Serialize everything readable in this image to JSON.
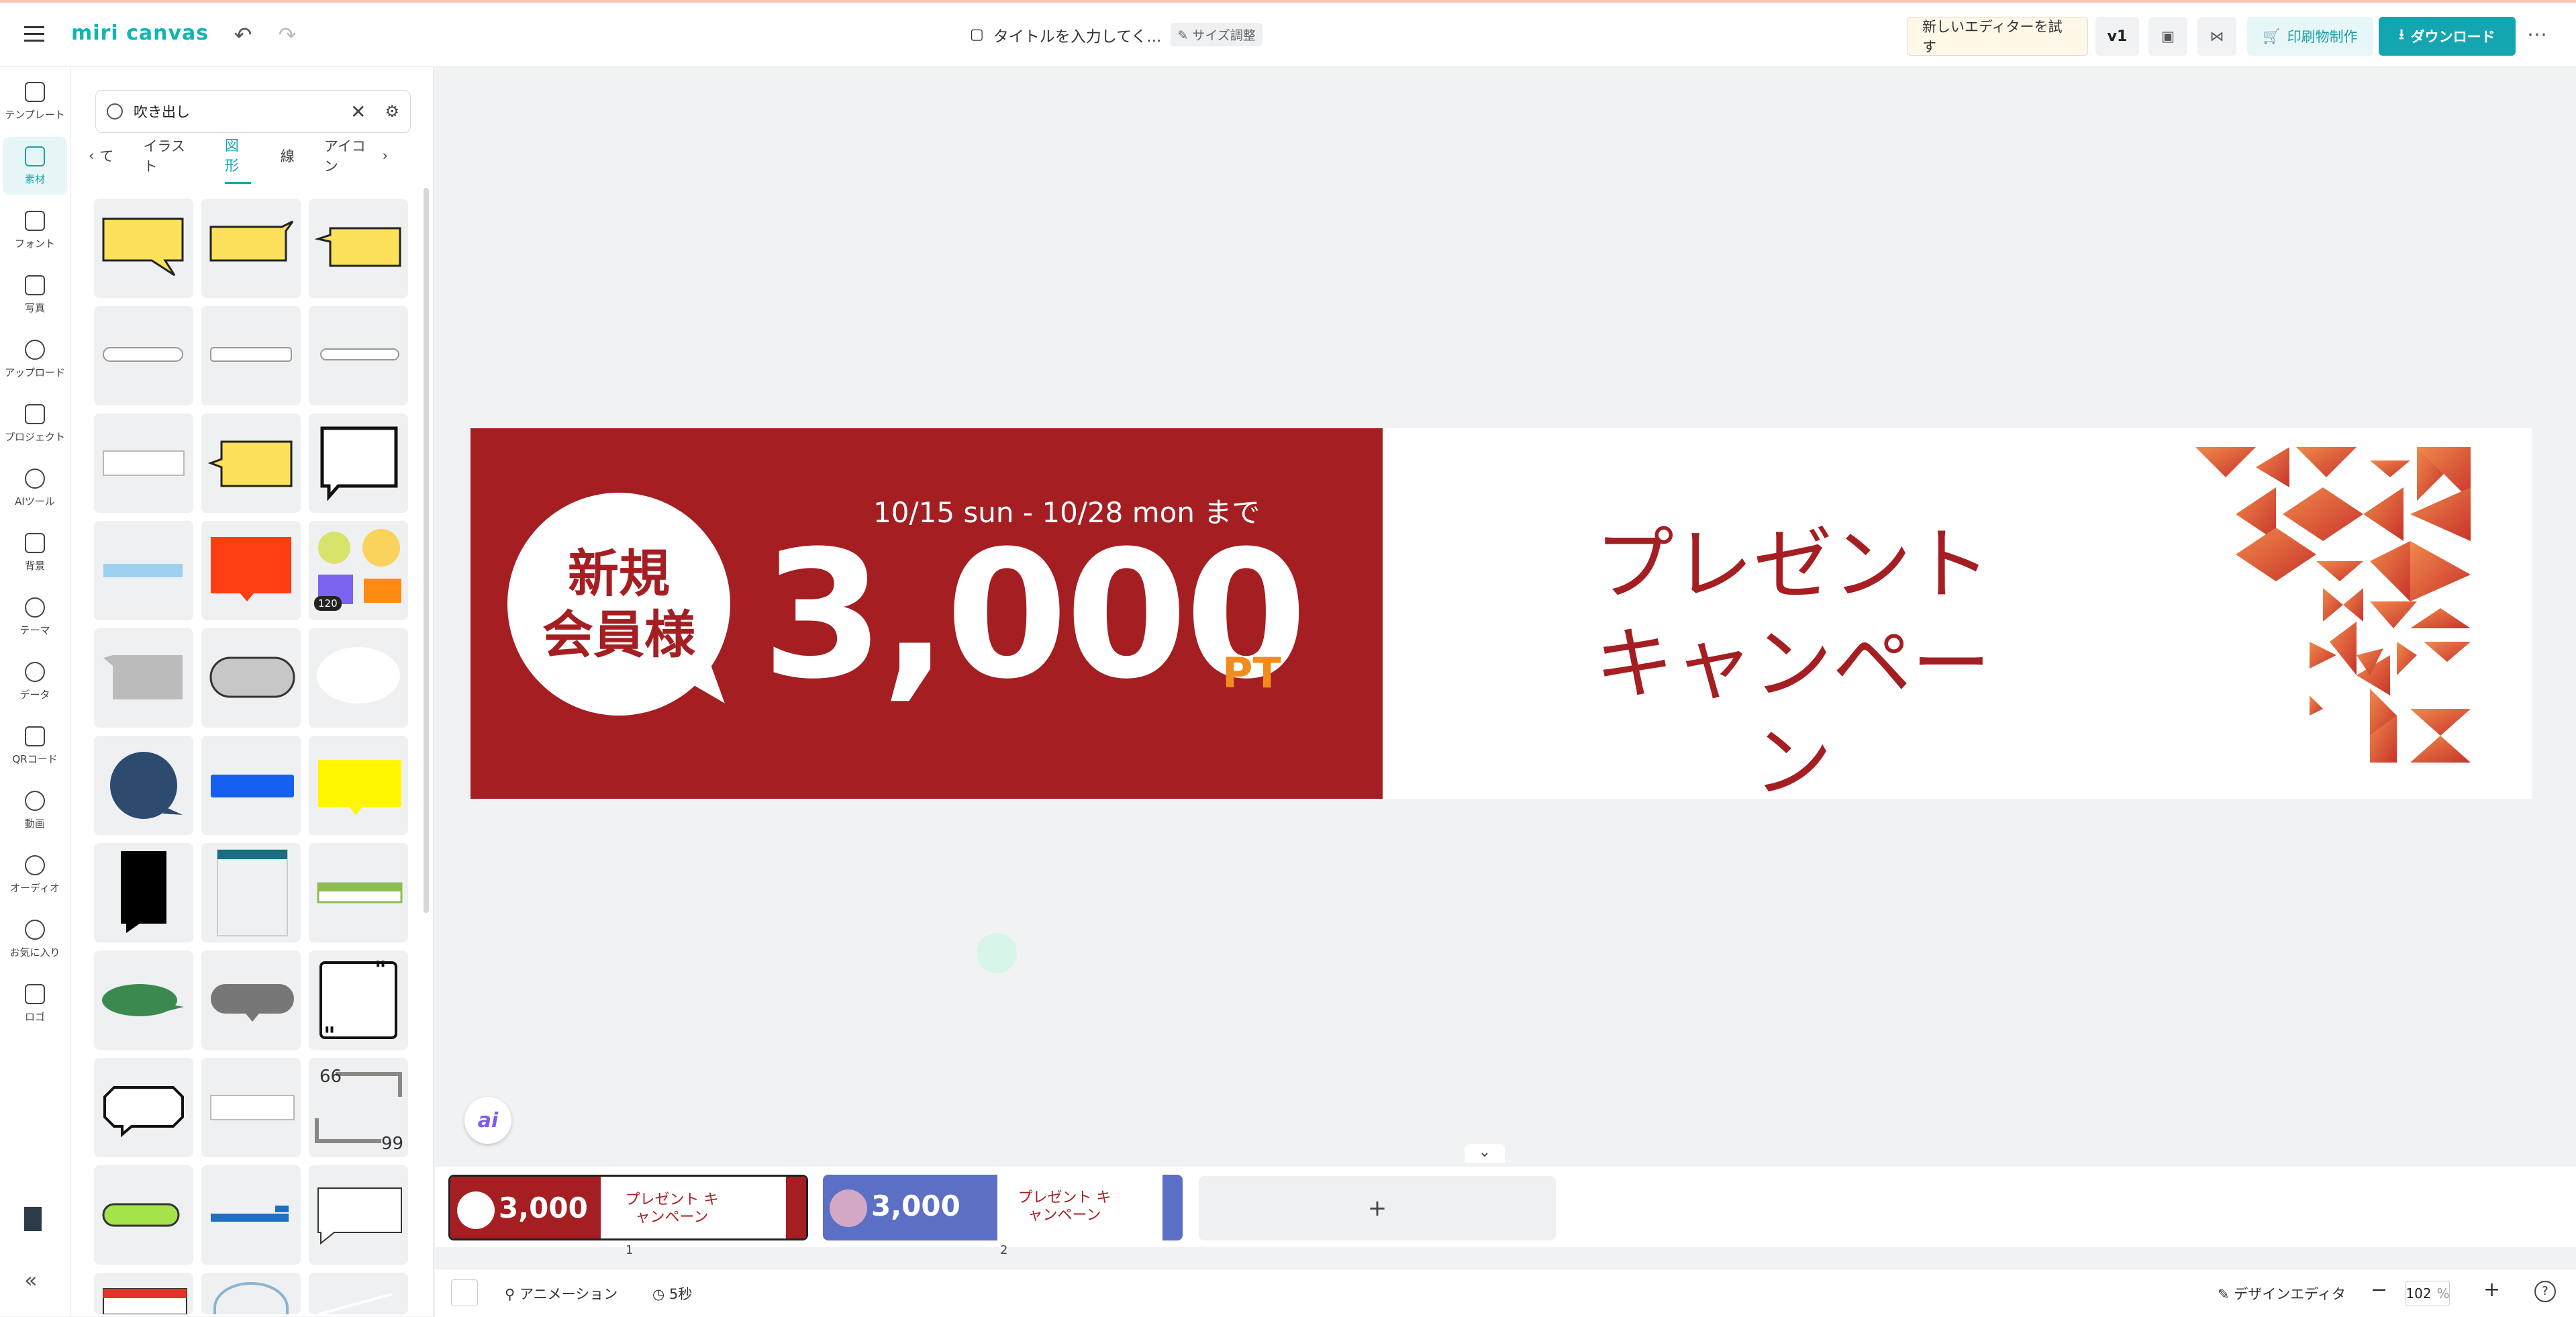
{
  "app": {
    "logo": "miri canvas"
  },
  "topbar": {
    "doc_title": "タイトルを入力してく...",
    "resize_chip": "サイズ調整",
    "try_new_editor": "新しいエディターを試す",
    "version": "v1",
    "print_label": "印刷物制作",
    "download_label": "ダウンロード",
    "more": "⋯"
  },
  "rail": {
    "items": [
      {
        "label": "テンプレート",
        "icon": "template-icon"
      },
      {
        "label": "素材",
        "icon": "elements-icon",
        "active": true
      },
      {
        "label": "フォント",
        "icon": "font-icon"
      },
      {
        "label": "写真",
        "icon": "photo-icon"
      },
      {
        "label": "アップロード",
        "icon": "upload-icon"
      },
      {
        "label": "プロジェクト",
        "icon": "project-icon"
      },
      {
        "label": "AIツール",
        "icon": "ai-tools-icon"
      },
      {
        "label": "背景",
        "icon": "background-icon"
      },
      {
        "label": "テーマ",
        "icon": "theme-icon"
      },
      {
        "label": "データ",
        "icon": "data-icon"
      },
      {
        "label": "QRコード",
        "icon": "qr-icon"
      },
      {
        "label": "動画",
        "icon": "video-icon"
      },
      {
        "label": "オーディオ",
        "icon": "audio-icon"
      },
      {
        "label": "お気に入り",
        "icon": "heart-icon"
      },
      {
        "label": "ロゴ",
        "icon": "logo-icon"
      }
    ]
  },
  "panel": {
    "search_value": "吹き出し",
    "tabs": [
      "て",
      "イラスト",
      "図形",
      "線",
      "アイコン"
    ],
    "active_tab": "図形",
    "badge_count": "120"
  },
  "banner": {
    "circle_line1": "新規",
    "circle_line2": "会員様",
    "dates": "10/15 sun - 10/28 mon まで",
    "amount": "3,000",
    "unit": "PT",
    "campaign_line1": "プレゼント",
    "campaign_line2": "キャンペーン",
    "colors": {
      "red": "#a51e22",
      "orange": "#f28c1c"
    }
  },
  "pages": [
    {
      "num": "1",
      "amount": "3,000",
      "campaign": "プレゼント キャンペーン"
    },
    {
      "num": "2",
      "amount": "3,000",
      "campaign": "プレゼント キャンペーン"
    }
  ],
  "add_page": "+",
  "bottombar": {
    "animation": "アニメーション",
    "duration": "5秒",
    "design_editor": "デザインエディタ",
    "zoom": "102",
    "zoom_unit": "%",
    "help": "?"
  },
  "ai_button": "ai"
}
